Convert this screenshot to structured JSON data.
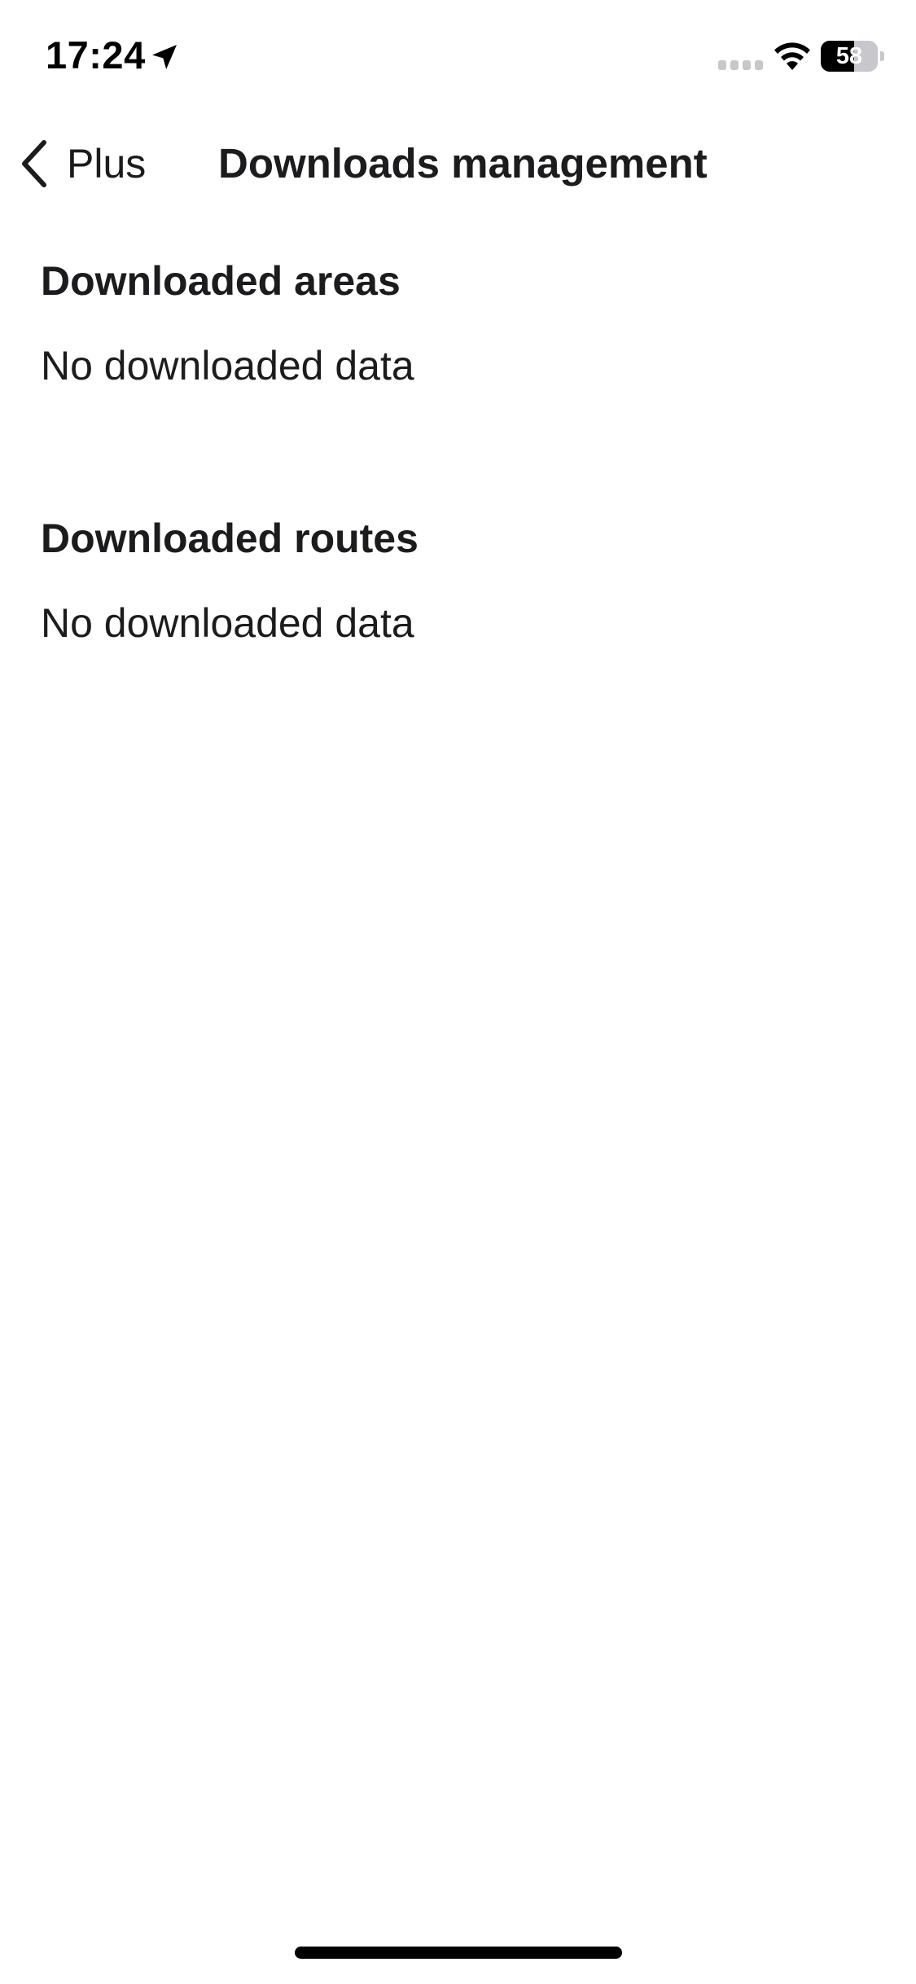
{
  "status_bar": {
    "time": "17:24",
    "battery_level": "58",
    "battery_fraction": 0.58,
    "icons": [
      "location-arrow-icon",
      "cellular-signal-icon",
      "wifi-icon",
      "battery-icon"
    ]
  },
  "nav": {
    "back_label": "Plus",
    "back_icon": "chevron-left-icon",
    "title": "Downloads management"
  },
  "sections": [
    {
      "title": "Downloaded areas",
      "empty_text": "No downloaded data"
    },
    {
      "title": "Downloaded routes",
      "empty_text": "No downloaded data"
    }
  ],
  "colors": {
    "text": "#1c1c1e",
    "background": "#ffffff",
    "inactive_gray": "#c7c7cc"
  }
}
